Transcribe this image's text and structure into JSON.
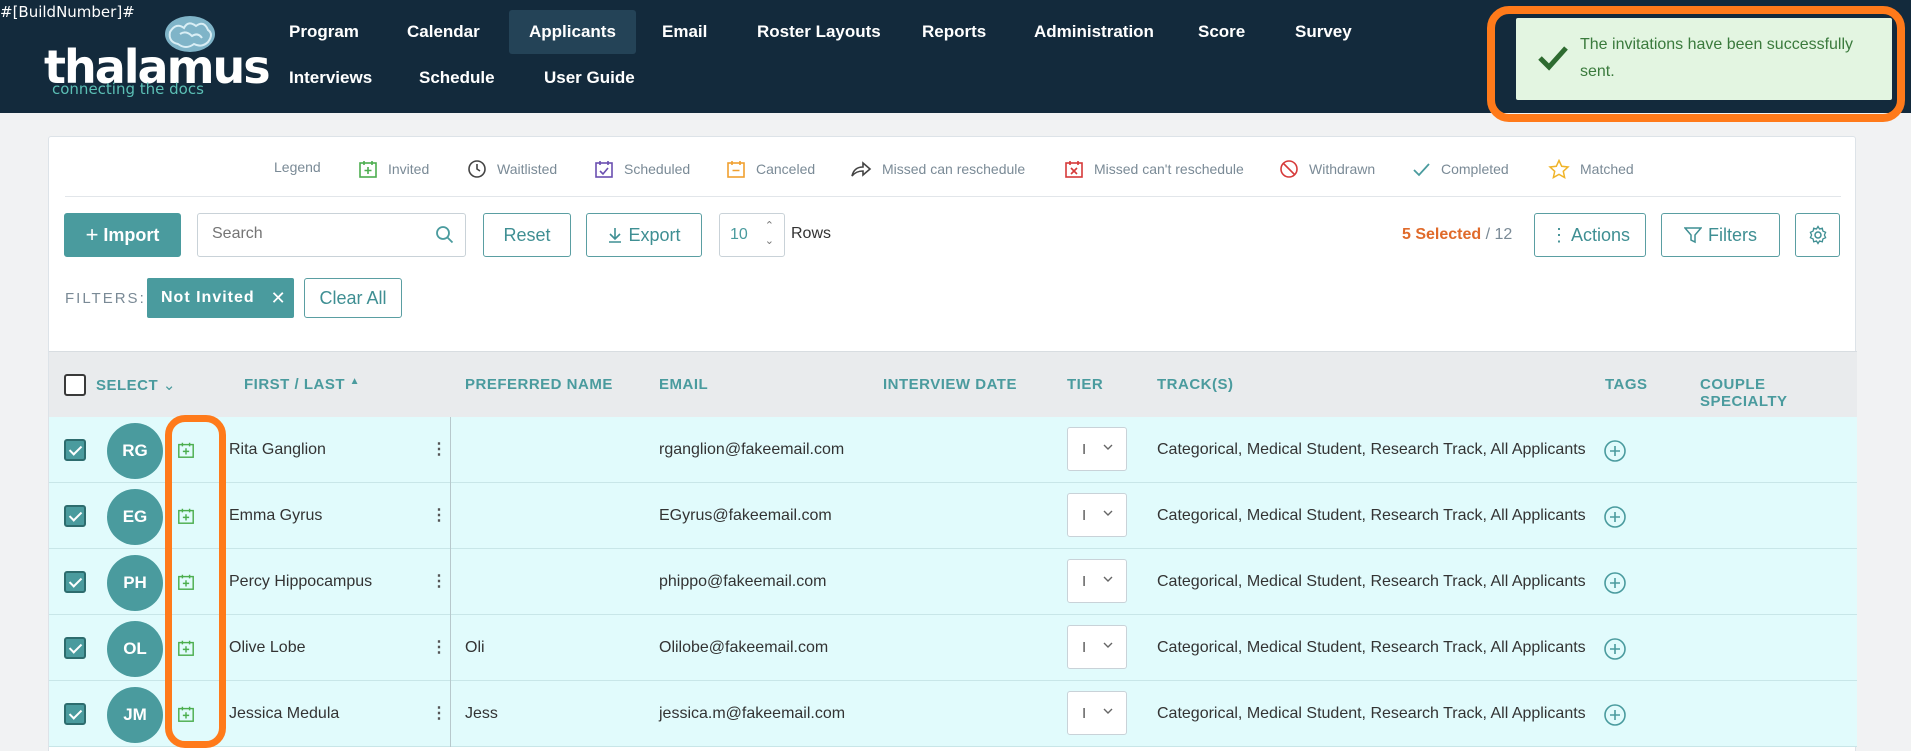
{
  "build_number": "#[BuildNumber]#",
  "logo": {
    "word": "thalamus",
    "tagline": "connecting the docs"
  },
  "nav": {
    "row1": [
      "Program",
      "Calendar",
      "Applicants",
      "Email",
      "Roster Layouts",
      "Reports",
      "Administration",
      "Score",
      "Survey"
    ],
    "row2": [
      "Interviews",
      "Schedule",
      "User Guide"
    ],
    "active": "Applicants"
  },
  "toast": {
    "message": "The invitations have been successfully sent."
  },
  "legend": {
    "title": "Legend",
    "items": [
      {
        "label": "Invited",
        "icon": "calendar-plus-icon",
        "color": "#4cae4f"
      },
      {
        "label": "Waitlisted",
        "icon": "clock-icon",
        "color": "#444444"
      },
      {
        "label": "Scheduled",
        "icon": "calendar-check-icon",
        "color": "#6a4fb0"
      },
      {
        "label": "Canceled",
        "icon": "calendar-minus-icon",
        "color": "#f0a030"
      },
      {
        "label": "Missed can reschedule",
        "icon": "share-arrow-icon",
        "color": "#444444"
      },
      {
        "label": "Missed can't reschedule",
        "icon": "calendar-x-icon",
        "color": "#d63a3a"
      },
      {
        "label": "Withdrawn",
        "icon": "ban-icon",
        "color": "#d63a3a"
      },
      {
        "label": "Completed",
        "icon": "check-icon",
        "color": "#4a9b9e"
      },
      {
        "label": "Matched",
        "icon": "star-icon",
        "color": "#f0b429"
      }
    ]
  },
  "toolbar": {
    "import_label": "Import",
    "search_placeholder": "Search",
    "reset_label": "Reset",
    "export_label": "Export",
    "rows_value": "10",
    "rows_label": "Rows",
    "selected_count": "5 Selected",
    "total_count": " / 12",
    "actions_label": "Actions",
    "filters_label": "Filters"
  },
  "filters": {
    "label": "FILTERS:",
    "chips": [
      "Not Invited"
    ],
    "clear_label": "Clear All"
  },
  "table": {
    "columns": {
      "select": "SELECT",
      "first_last": "FIRST / LAST",
      "preferred": "PREFERRED NAME",
      "email": "EMAIL",
      "interview_date": "INTERVIEW DATE",
      "tier": "TIER",
      "tracks": "TRACK(S)",
      "tags": "TAGS",
      "couple": "COUPLE SPECIALTY"
    },
    "rows": [
      {
        "initials": "RG",
        "name": "Rita Ganglion",
        "preferred": "",
        "email": "rganglion@fakeemail.com",
        "interview_date": "",
        "tier": "I",
        "tracks": "Categorical, Medical Student, Research Track, All Applicants",
        "checked": true,
        "status": "Invited"
      },
      {
        "initials": "EG",
        "name": "Emma Gyrus",
        "preferred": "",
        "email": "EGyrus@fakeemail.com",
        "interview_date": "",
        "tier": "I",
        "tracks": "Categorical, Medical Student, Research Track, All Applicants",
        "checked": true,
        "status": "Invited"
      },
      {
        "initials": "PH",
        "name": "Percy Hippocampus",
        "preferred": "",
        "email": "phippo@fakeemail.com",
        "interview_date": "",
        "tier": "I",
        "tracks": "Categorical, Medical Student, Research Track, All Applicants",
        "checked": true,
        "status": "Invited"
      },
      {
        "initials": "OL",
        "name": "Olive Lobe",
        "preferred": "Oli",
        "email": "Olilobe@fakeemail.com",
        "interview_date": "",
        "tier": "I",
        "tracks": "Categorical, Medical Student, Research Track, All Applicants",
        "checked": true,
        "status": "Invited"
      },
      {
        "initials": "JM",
        "name": "Jessica Medula",
        "preferred": "Jess",
        "email": "jessica.m@fakeemail.com",
        "interview_date": "",
        "tier": "I",
        "tracks": "Categorical, Medical Student, Research Track, All Applicants",
        "checked": true,
        "status": "Invited"
      }
    ]
  },
  "colors": {
    "accent": "#4a9b9e",
    "nav_bg": "#132a3c",
    "highlight": "#ff7a1a",
    "row_bg": "#e1fbfc"
  }
}
